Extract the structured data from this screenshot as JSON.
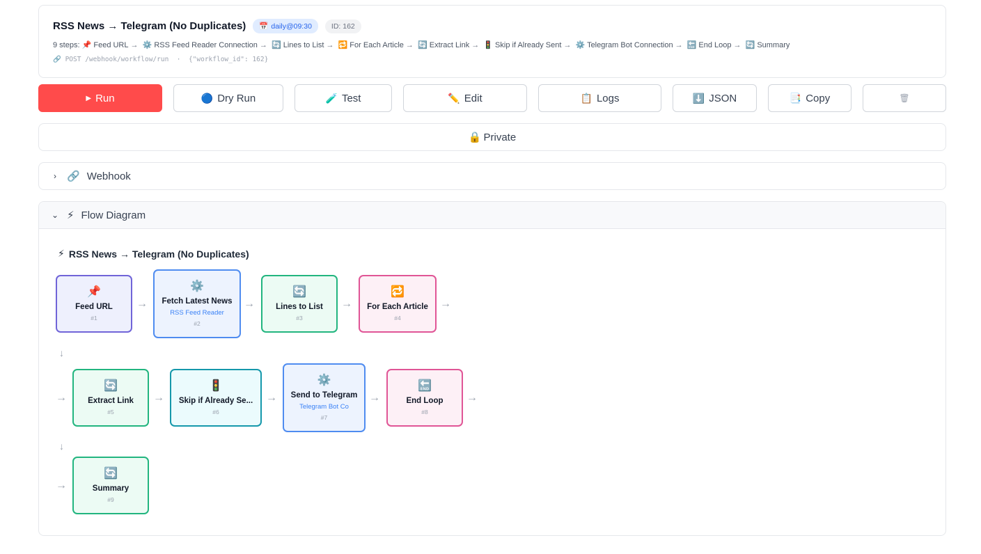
{
  "header": {
    "title": "RSS News → Telegram (No Duplicates)",
    "schedule_badge": "daily@09:30",
    "schedule_icon": "calendar-icon",
    "id_badge": "ID: 162",
    "steps_prefix": "9 steps:",
    "steps": [
      {
        "icon": "📌",
        "label": "Feed URL"
      },
      {
        "icon": "⚙️",
        "label": "RSS Feed Reader Connection"
      },
      {
        "icon": "🔄",
        "label": "Lines to List"
      },
      {
        "icon": "🔁",
        "label": "For Each Article"
      },
      {
        "icon": "🔄",
        "label": "Extract Link"
      },
      {
        "icon": "🚦",
        "label": "Skip if Already Sent"
      },
      {
        "icon": "⚙️",
        "label": "Telegram Bot Connection"
      },
      {
        "icon": "🔚",
        "label": "End Loop"
      },
      {
        "icon": "🔄",
        "label": "Summary"
      }
    ],
    "webhook_method": "POST",
    "webhook_path": "/webhook/workflow/run",
    "webhook_separator": "·",
    "webhook_body": "{\"workflow_id\": 162}"
  },
  "toolbar": {
    "run": {
      "icon": "▶",
      "label": "Run"
    },
    "dry_run": {
      "icon": "🔵",
      "label": "Dry Run"
    },
    "test": {
      "icon": "🧪",
      "label": "Test"
    },
    "edit": {
      "icon": "✏️",
      "label": "Edit"
    },
    "logs": {
      "icon": "📋",
      "label": "Logs"
    },
    "json": {
      "icon": "⬇️",
      "label": "JSON"
    },
    "copy": {
      "icon": "📑",
      "label": "Copy"
    },
    "delete": {
      "icon": "🗑"
    }
  },
  "private_toggle": {
    "icon": "🔒",
    "label": "Private"
  },
  "webhook_expander": {
    "icon": "🔗",
    "label": "Webhook"
  },
  "flow_expander": {
    "icon": "⚡",
    "label": "Flow Diagram"
  },
  "diagram": {
    "title": "RSS News → Telegram (No Duplicates)",
    "title_icon": "⚡",
    "nodes": [
      {
        "icon": "📌",
        "label": "Feed URL",
        "sub": "",
        "num": "#1"
      },
      {
        "icon": "⚙️",
        "label": "Fetch Latest News",
        "sub": "RSS Feed Reader",
        "num": "#2"
      },
      {
        "icon": "🔄",
        "label": "Lines to List",
        "sub": "",
        "num": "#3"
      },
      {
        "icon": "🔁",
        "label": "For Each Article",
        "sub": "",
        "num": "#4"
      },
      {
        "icon": "🔄",
        "label": "Extract Link",
        "sub": "",
        "num": "#5"
      },
      {
        "icon": "🚦",
        "label": "Skip if Already Se...",
        "sub": "",
        "num": "#6"
      },
      {
        "icon": "⚙️",
        "label": "Send to Telegram",
        "sub": "Telegram Bot Co",
        "num": "#7"
      },
      {
        "icon": "🔚",
        "label": "End Loop",
        "sub": "",
        "num": "#8"
      },
      {
        "icon": "🔄",
        "label": "Summary",
        "sub": "",
        "num": "#9"
      }
    ],
    "arrow_right": "→",
    "arrow_down": "↓"
  }
}
